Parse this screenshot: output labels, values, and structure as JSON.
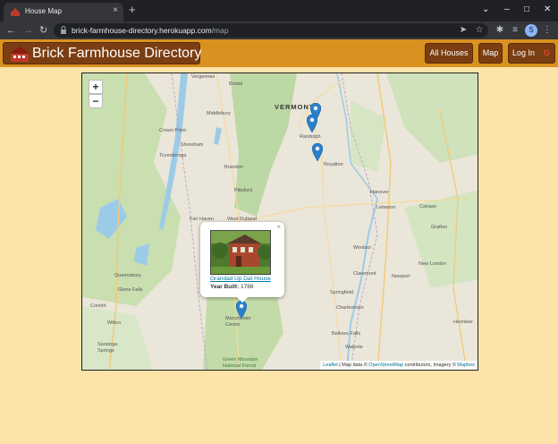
{
  "browser": {
    "tab_title": "House Map",
    "new_tab_label": "+",
    "url_host": "brick-farmhouse-directory.herokuapp.com",
    "url_path": "/map",
    "profile_initial": "S"
  },
  "navbar": {
    "brand_text": "Brick Farmhouse Directory",
    "all_houses_label": "All Houses",
    "map_label": "Map",
    "login_label": "Log In"
  },
  "map": {
    "zoom_in_label": "+",
    "zoom_out_label": "−",
    "popup": {
      "close_label": "×",
      "house_link": "Grandad Up Dat House",
      "year_label": "Year Built:",
      "year_value": "1788"
    },
    "labels": {
      "vergennes": "Vergennes",
      "bristol": "Bristol",
      "vermont": "VERMONT",
      "middlebury": "Middlebury",
      "crown_point": "Crown Point",
      "randolph": "Randolph",
      "shoreham": "Shoreham",
      "ticonderoga": "Ticonderoga",
      "brandon": "Brandon",
      "royalton": "Royalton",
      "pittsford": "Pittsford",
      "hanover": "Hanover",
      "fair_haven": "Fair Haven",
      "west_rutland": "West Rutland",
      "lebanon": "Lebanon",
      "canaan": "Canaan",
      "grafton": "Grafton",
      "windsor": "Windsor",
      "claremont": "Claremont",
      "new_london": "New London",
      "newport": "Newport",
      "queensbury": "Queensbury",
      "glens_falls": "Glens Falls",
      "springfield": "Springfield",
      "charlestown": "Charlestown",
      "corinth": "Corinth",
      "manchester_center": "Manchester Center",
      "wilton": "Wilton",
      "henniker": "Henniker",
      "saratoga_springs": "Saratoga Springs",
      "bellows_falls": "Bellows Falls",
      "walpole": "Walpole",
      "green_mountain": "Green Mountain National Forest"
    },
    "attribution": {
      "leaflet": "Leaflet",
      "text": " | Map data © ",
      "osm": "OpenStreetMap",
      "text2": " contributors, Imagery © ",
      "mapbox": "Mapbox"
    }
  },
  "colors": {
    "page_bg": "#fde3a8",
    "navbar_bg": "#d9921f",
    "button_bg": "#7a3e12",
    "marker": "#2a81cb"
  }
}
